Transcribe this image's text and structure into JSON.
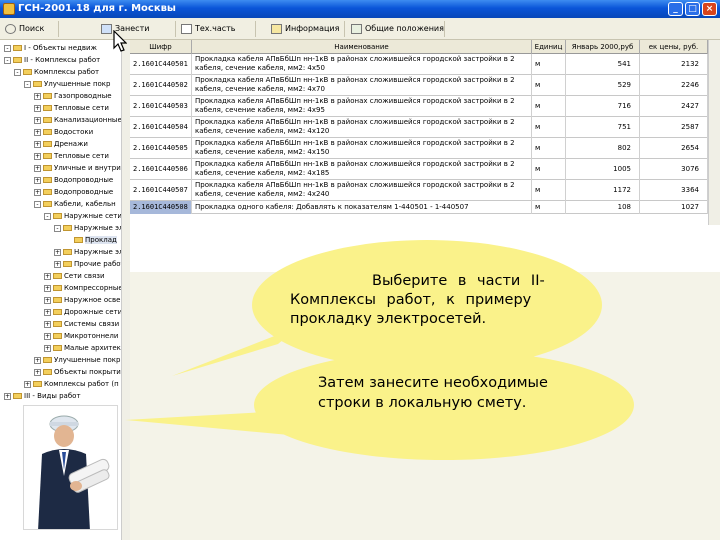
{
  "window": {
    "title": "ГСН-2001.18 для г. Москвы",
    "buttons": {
      "minimize": "_",
      "maximize": "□",
      "close": "×"
    }
  },
  "toolbar": {
    "items": [
      "Поиск",
      "Занести",
      "Тех.часть",
      "Информация",
      "Общие положения"
    ]
  },
  "tree": {
    "items": [
      {
        "pm": "-",
        "label": "I - Объекты недвиж"
      },
      {
        "pm": "-",
        "label": "II - Комплексы работ"
      },
      {
        "pm": "-",
        "label": "Комплексы работ"
      },
      {
        "pm": "-",
        "label": "Улучшенные покр"
      },
      {
        "pm": "+",
        "label": "Газопроводные"
      },
      {
        "pm": "+",
        "label": "Тепловые сети"
      },
      {
        "pm": "+",
        "label": "Канализационные"
      },
      {
        "pm": "+",
        "label": "Водостоки"
      },
      {
        "pm": "+",
        "label": "Дренажи"
      },
      {
        "pm": "+",
        "label": "Тепловые сети"
      },
      {
        "pm": "+",
        "label": "Уличные и внутрикв"
      },
      {
        "pm": "+",
        "label": "Водопроводные"
      },
      {
        "pm": "+",
        "label": "Водопроводные"
      },
      {
        "pm": "-",
        "label": "Кабели, кабельн"
      },
      {
        "pm": "-",
        "label": "Наружные сети"
      },
      {
        "pm": "-",
        "label": "Наружные эл"
      },
      {
        "pm": "",
        "label": "Проклад"
      },
      {
        "pm": "+",
        "label": "Наружные эл"
      },
      {
        "pm": "+",
        "label": "Прочие работ"
      },
      {
        "pm": "+",
        "label": "Сети связи"
      },
      {
        "pm": "+",
        "label": "Компрессорные"
      },
      {
        "pm": "+",
        "label": "Наружное освещ"
      },
      {
        "pm": "+",
        "label": "Дорожные сети"
      },
      {
        "pm": "+",
        "label": "Системы связи"
      },
      {
        "pm": "+",
        "label": "Микротоннели"
      },
      {
        "pm": "+",
        "label": "Малые архитект"
      },
      {
        "pm": "+",
        "label": "Улучшенные покр"
      },
      {
        "pm": "+",
        "label": "Объекты покрытий"
      },
      {
        "pm": "+",
        "label": "Комплексы работ (п"
      },
      {
        "pm": "+",
        "label": "III - Виды работ"
      }
    ]
  },
  "grid": {
    "columns": [
      "Шифр",
      "Наименование",
      "Единиц",
      "Январь 2000,руб",
      "ек цены, руб."
    ],
    "rows": [
      {
        "code": "2.1601C440501",
        "name": "Прокладка кабеля АПвБбШп нн-1кВ в районах сложившейся городской застройки в 2 кабеля, сечение кабеля, мм2: 4x50",
        "unit": "м",
        "p2000": "541",
        "pcur": "2132"
      },
      {
        "code": "2.1601C440502",
        "name": "Прокладка кабеля АПвБбШп нн-1кВ в районах сложившейся городской застройки в 2 кабеля, сечение кабеля, мм2: 4x70",
        "unit": "м",
        "p2000": "529",
        "pcur": "2246"
      },
      {
        "code": "2.1601C440503",
        "name": "Прокладка кабеля АПвБбШп нн-1кВ в районах сложившейся городской застройки в 2 кабеля, сечение кабеля, мм2: 4x95",
        "unit": "м",
        "p2000": "716",
        "pcur": "2427"
      },
      {
        "code": "2.1601C440504",
        "name": "Прокладка кабеля АПвБбШп нн-1кВ в районах сложившейся городской застройки в 2 кабеля, сечение кабеля, мм2: 4x120",
        "unit": "м",
        "p2000": "751",
        "pcur": "2587"
      },
      {
        "code": "2.1601C440505",
        "name": "Прокладка кабеля АПвБбШп нн-1кВ в районах сложившейся городской застройки в 2 кабеля, сечение кабеля, мм2: 4x150",
        "unit": "м",
        "p2000": "802",
        "pcur": "2654"
      },
      {
        "code": "2.1601C440506",
        "name": "Прокладка кабеля АПвБбШп нн-1кВ в районах сложившейся городской застройки в 2 кабеля, сечение кабеля, мм2: 4x185",
        "unit": "м",
        "p2000": "1005",
        "pcur": "3076"
      },
      {
        "code": "2.1601C440507",
        "name": "Прокладка кабеля АПвБбШп нн-1кВ в районах сложившейся городской застройки в 2 кабеля, сечение кабеля, мм2: 4x240",
        "unit": "м",
        "p2000": "1172",
        "pcur": "3364"
      },
      {
        "code": "2.1601C440508",
        "name": "Прокладка одного кабеля: Добавлять к показателям 1-440501 - 1-440507",
        "unit": "м",
        "p2000": "108",
        "pcur": "1027"
      }
    ]
  },
  "callout": {
    "line1": "Выберите в части II-",
    "line2": "Комплексы работ, к примеру",
    "line3": "прокладку электросетей.",
    "line4": "Затем занесите необходимые",
    "line5": "строки в локальную смету."
  },
  "colors": {
    "bubble": "#faf28a",
    "titlebar": "#0a55d8",
    "selection": "#a6b8da"
  }
}
